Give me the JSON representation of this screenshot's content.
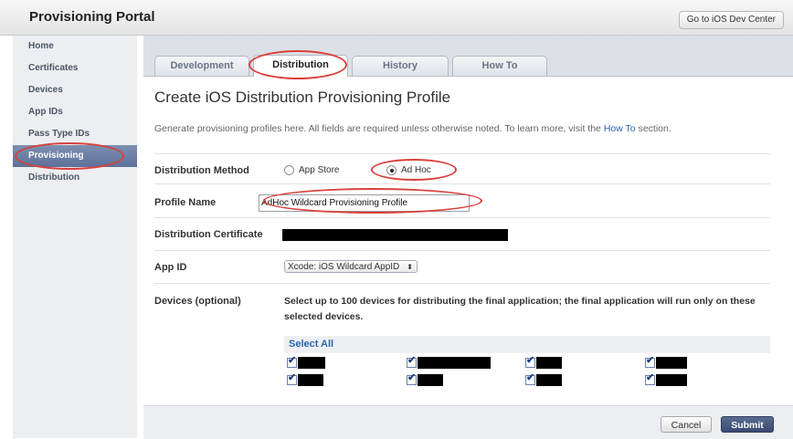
{
  "header": {
    "title": "Provisioning Portal",
    "dev_center_label": "Go to iOS Dev Center"
  },
  "sidebar": {
    "items": [
      "Home",
      "Certificates",
      "Devices",
      "App IDs",
      "Pass Type IDs",
      "Provisioning",
      "Distribution"
    ],
    "active": "Provisioning"
  },
  "tabs": {
    "items": [
      "Development",
      "Distribution",
      "History",
      "How To"
    ],
    "active": "Distribution"
  },
  "page": {
    "heading": "Create iOS Distribution Provisioning Profile",
    "intro_before": "Generate provisioning profiles here. All fields are required unless otherwise noted. To learn more, visit the ",
    "intro_link": "How To",
    "intro_after": " section."
  },
  "form": {
    "distribution_method": {
      "label": "Distribution Method",
      "options": [
        "App Store",
        "Ad Hoc"
      ],
      "selected": "Ad Hoc"
    },
    "profile_name": {
      "label": "Profile Name",
      "value": "AdHoc Wildcard Provisioning Profile"
    },
    "distribution_certificate": {
      "label": "Distribution Certificate"
    },
    "app_id": {
      "label": "App ID",
      "selected": "Xcode: iOS Wildcard AppID"
    },
    "devices": {
      "label": "Devices (optional)",
      "description": "Select up to 100 devices for distributing the final application; the final application will run only on these selected devices.",
      "select_all_label": "Select All",
      "checked_count": 8
    }
  },
  "buttons": {
    "cancel": "Cancel",
    "submit": "Submit"
  },
  "colors": {
    "accent": "#5e7098",
    "link": "#2a64b0",
    "highlight": "#d9403a"
  }
}
